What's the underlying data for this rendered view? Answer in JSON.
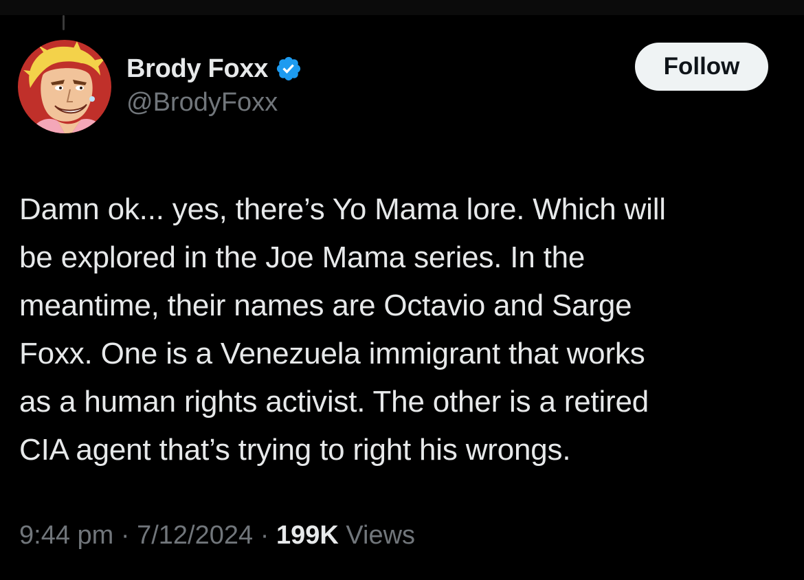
{
  "colors": {
    "background": "#000000",
    "primary_text": "#e7e9ea",
    "secondary_text": "#71767b",
    "verified_badge": "#1d9bf0",
    "follow_button_bg": "#eff3f4",
    "follow_button_text": "#0f1419"
  },
  "author": {
    "display_name": "Brody Foxx",
    "handle": "@BrodyFoxx",
    "verified": true,
    "avatar_icon": "cartoon-avatar"
  },
  "follow_button": {
    "label": "Follow"
  },
  "tweet": {
    "text": "Damn ok... yes, there’s Yo Mama lore. Which will\nbe explored in the Joe Mama series. In the\nmeantime, their names are Octavio and Sarge\nFoxx. One is a Venezuela immigrant that works\nas a human rights activist. The other is a retired\nCIA agent that’s trying to right his wrongs."
  },
  "meta": {
    "time": "9:44 pm",
    "separator": " · ",
    "date": "7/12/2024",
    "views_count": "199K",
    "views_label": " Views"
  }
}
